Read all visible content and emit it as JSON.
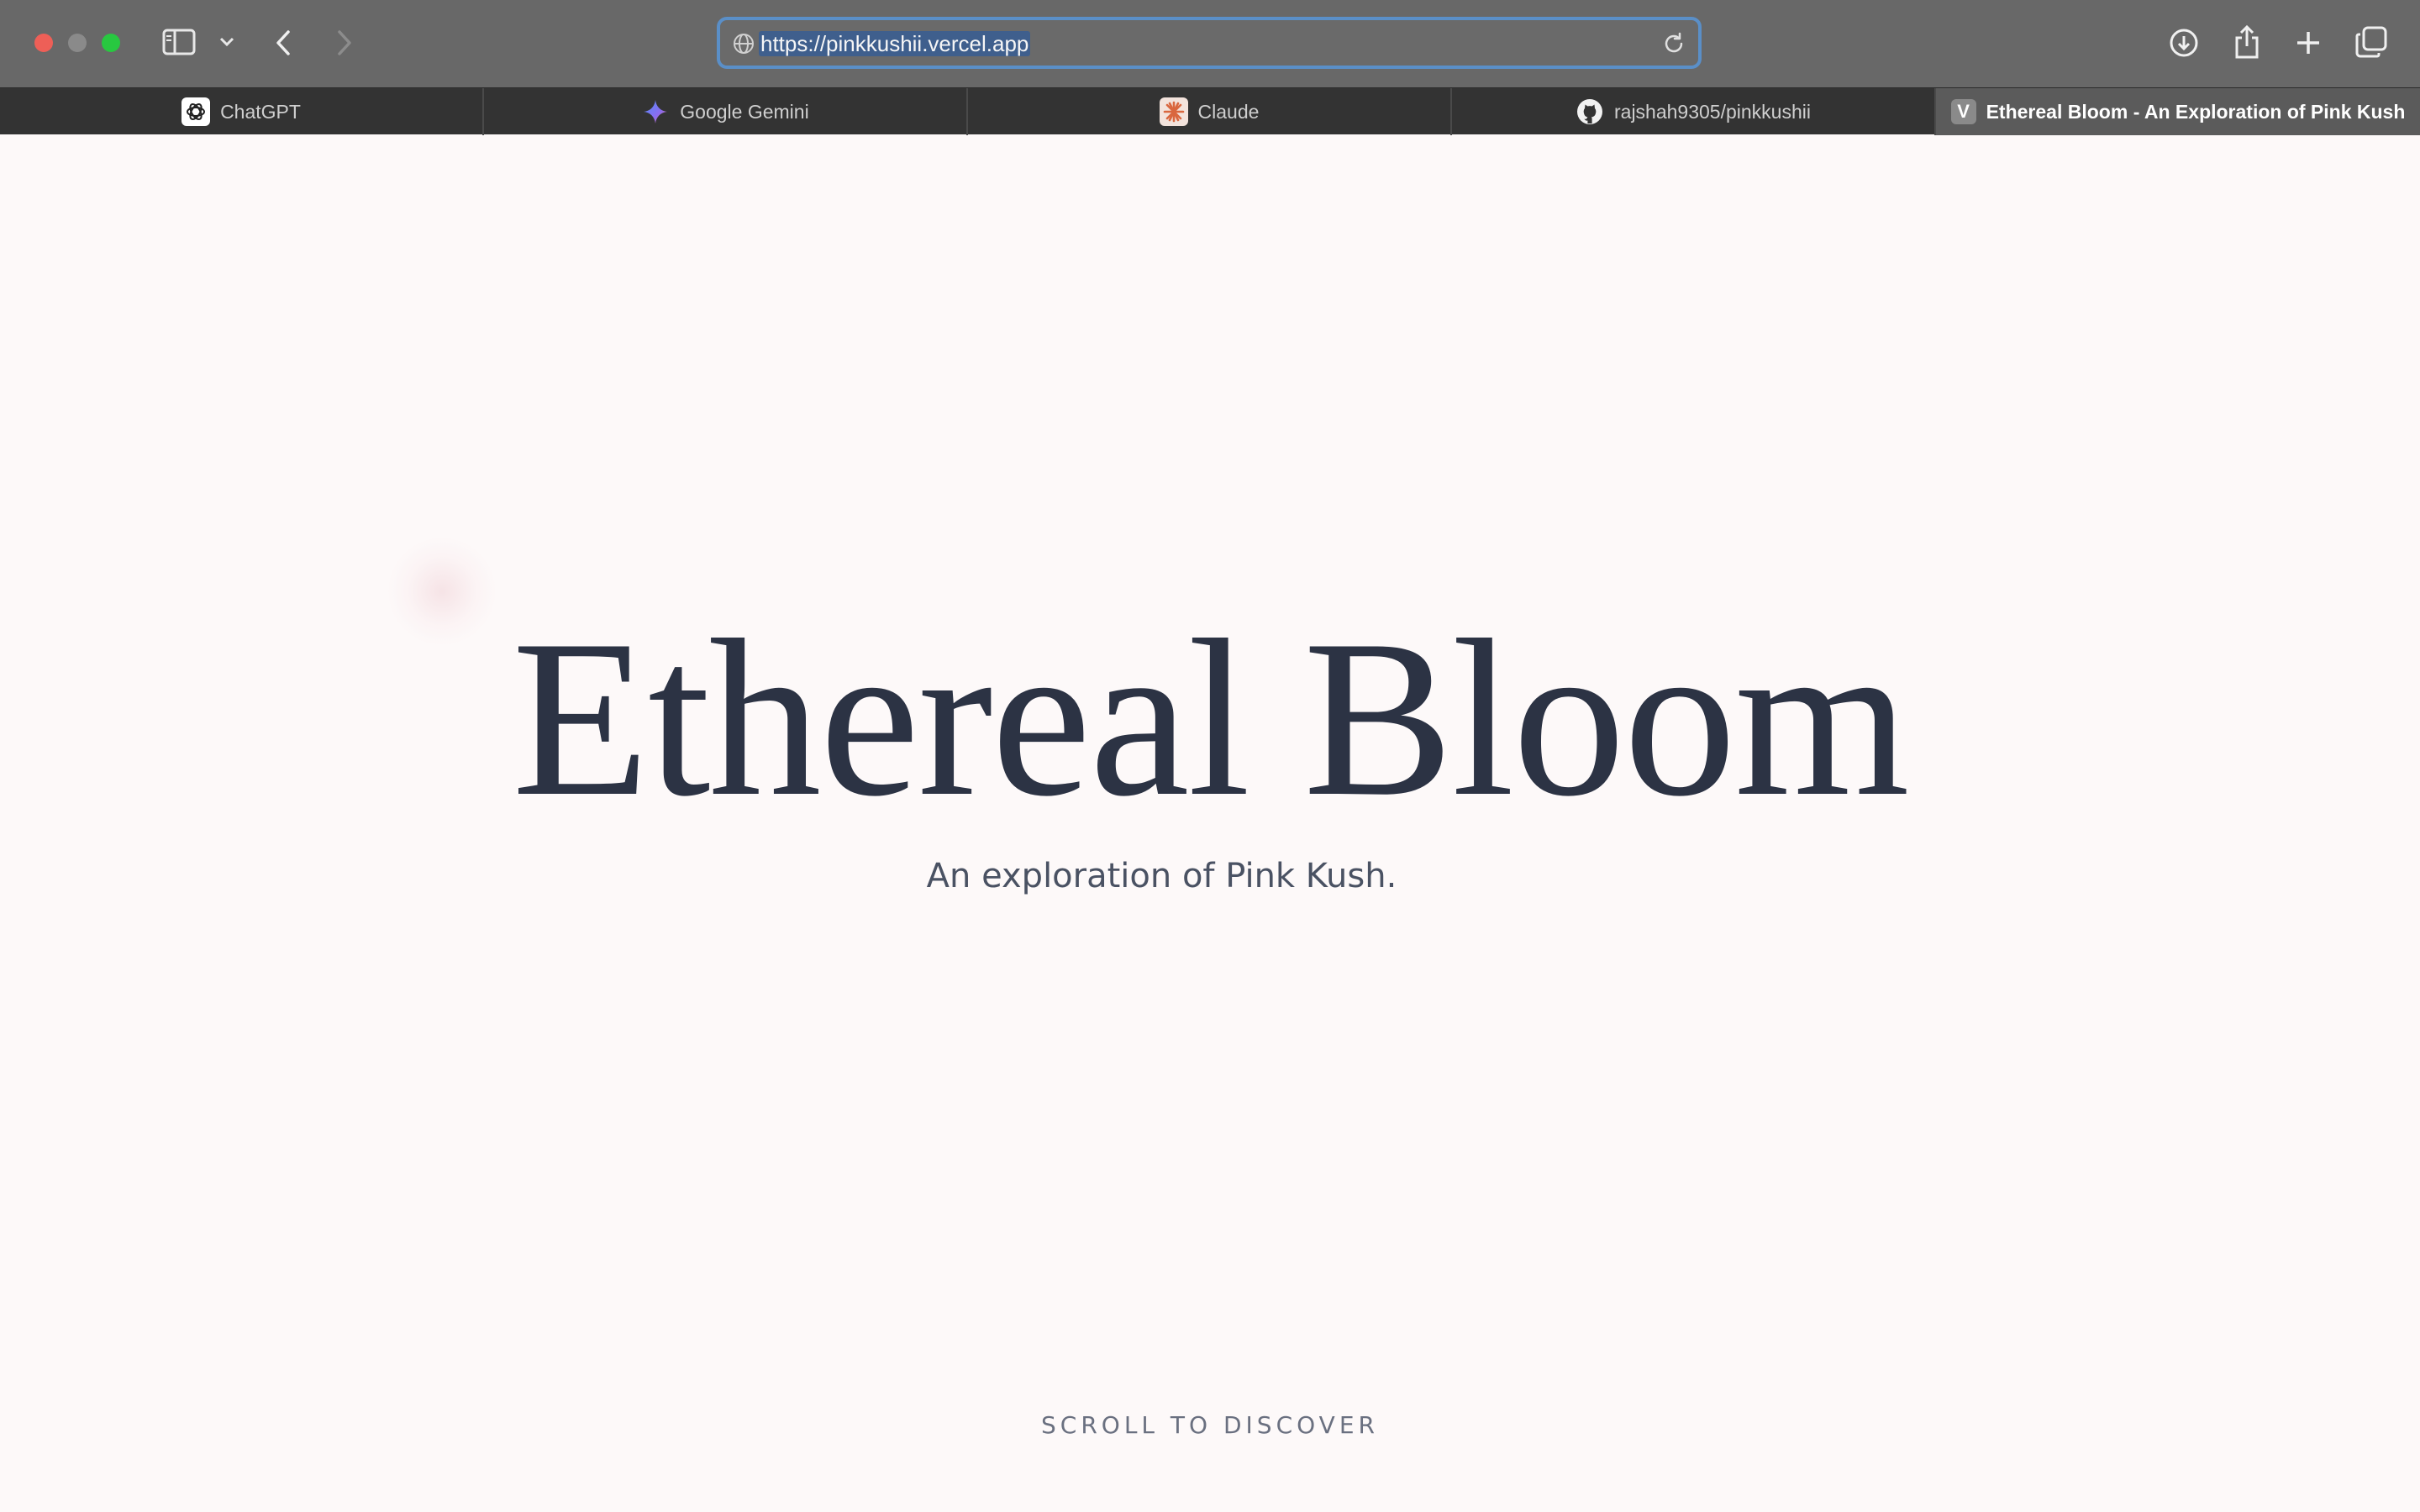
{
  "browser": {
    "url": "https://pinkkushii.vercel.app",
    "tabs": [
      {
        "label": "ChatGPT",
        "icon": "chatgpt-icon"
      },
      {
        "label": "Google Gemini",
        "icon": "gemini-icon"
      },
      {
        "label": "Claude",
        "icon": "claude-icon"
      },
      {
        "label": "rajshah9305/pinkkushii",
        "icon": "github-icon"
      },
      {
        "label": "Ethereal Bloom - An Exploration of Pink Kush",
        "icon": "vercel-v-icon",
        "favicon_letter": "V",
        "active": true
      }
    ],
    "colors": {
      "toolbar": "#686868",
      "tabbar": "#333333",
      "url_focus_ring": "#5a8fc8"
    }
  },
  "page": {
    "title": "Ethereal Bloom",
    "subtitle": "An exploration of Pink Kush.",
    "scroll_cue": "SCROLL TO DISCOVER",
    "colors": {
      "background": "#fdf9f9",
      "title": "#2c3344",
      "subtitle": "#4a5263"
    }
  }
}
